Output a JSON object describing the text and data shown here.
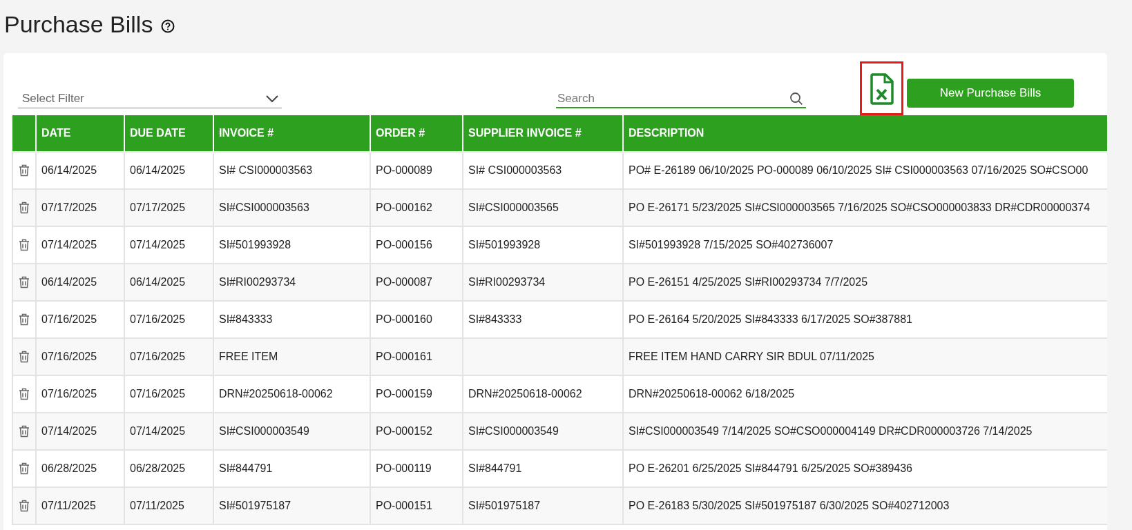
{
  "page": {
    "title": "Purchase Bills"
  },
  "toolbar": {
    "filter": {
      "placeholder": "Select Filter"
    },
    "search": {
      "placeholder": "Search"
    },
    "new_button": "New Purchase Bills"
  },
  "table": {
    "columns": [
      "DATE",
      "DUE DATE",
      "INVOICE #",
      "ORDER #",
      "SUPPLIER INVOICE #",
      "DESCRIPTION"
    ],
    "rows": [
      [
        "06/14/2025",
        "06/14/2025",
        "SI# CSI000003563",
        "PO-000089",
        "SI# CSI000003563",
        "PO# E-26189 06/10/2025 PO-000089 06/10/2025 SI# CSI000003563 07/16/2025 SO#CSO00"
      ],
      [
        "07/17/2025",
        "07/17/2025",
        "SI#CSI000003563",
        "PO-000162",
        "SI#CSI000003565",
        "PO E-26171 5/23/2025 SI#CSI000003565 7/16/2025 SO#CSO000003833 DR#CDR00000374"
      ],
      [
        "07/14/2025",
        "07/14/2025",
        "SI#501993928",
        "PO-000156",
        "SI#501993928",
        "SI#501993928 7/15/2025 SO#402736007"
      ],
      [
        "06/14/2025",
        "06/14/2025",
        "SI#RI00293734",
        "PO-000087",
        "SI#RI00293734",
        "PO E-26151 4/25/2025 SI#RI00293734 7/7/2025"
      ],
      [
        "07/16/2025",
        "07/16/2025",
        "SI#843333",
        "PO-000160",
        "SI#843333",
        "PO E-26164 5/20/2025 SI#843333 6/17/2025 SO#387881"
      ],
      [
        "07/16/2025",
        "07/16/2025",
        "FREE ITEM",
        "PO-000161",
        "",
        "FREE ITEM HAND CARRY SIR BDUL 07/11/2025"
      ],
      [
        "07/16/2025",
        "07/16/2025",
        "DRN#20250618-00062",
        "PO-000159",
        "DRN#20250618-00062",
        "DRN#20250618-00062 6/18/2025"
      ],
      [
        "07/14/2025",
        "07/14/2025",
        "SI#CSI000003549",
        "PO-000152",
        "SI#CSI000003549",
        "SI#CSI000003549 7/14/2025 SO#CSO000004149 DR#CDR000003726 7/14/2025"
      ],
      [
        "06/28/2025",
        "06/28/2025",
        "SI#844791",
        "PO-000119",
        "SI#844791",
        "PO E-26201 6/25/2025 SI#844791 6/25/2025 SO#389436"
      ],
      [
        "07/11/2025",
        "07/11/2025",
        "SI#501975187",
        "PO-000151",
        "SI#501975187",
        "PO E-26183 5/30/2025 SI#501975187 6/30/2025 SO#402712003"
      ]
    ]
  }
}
